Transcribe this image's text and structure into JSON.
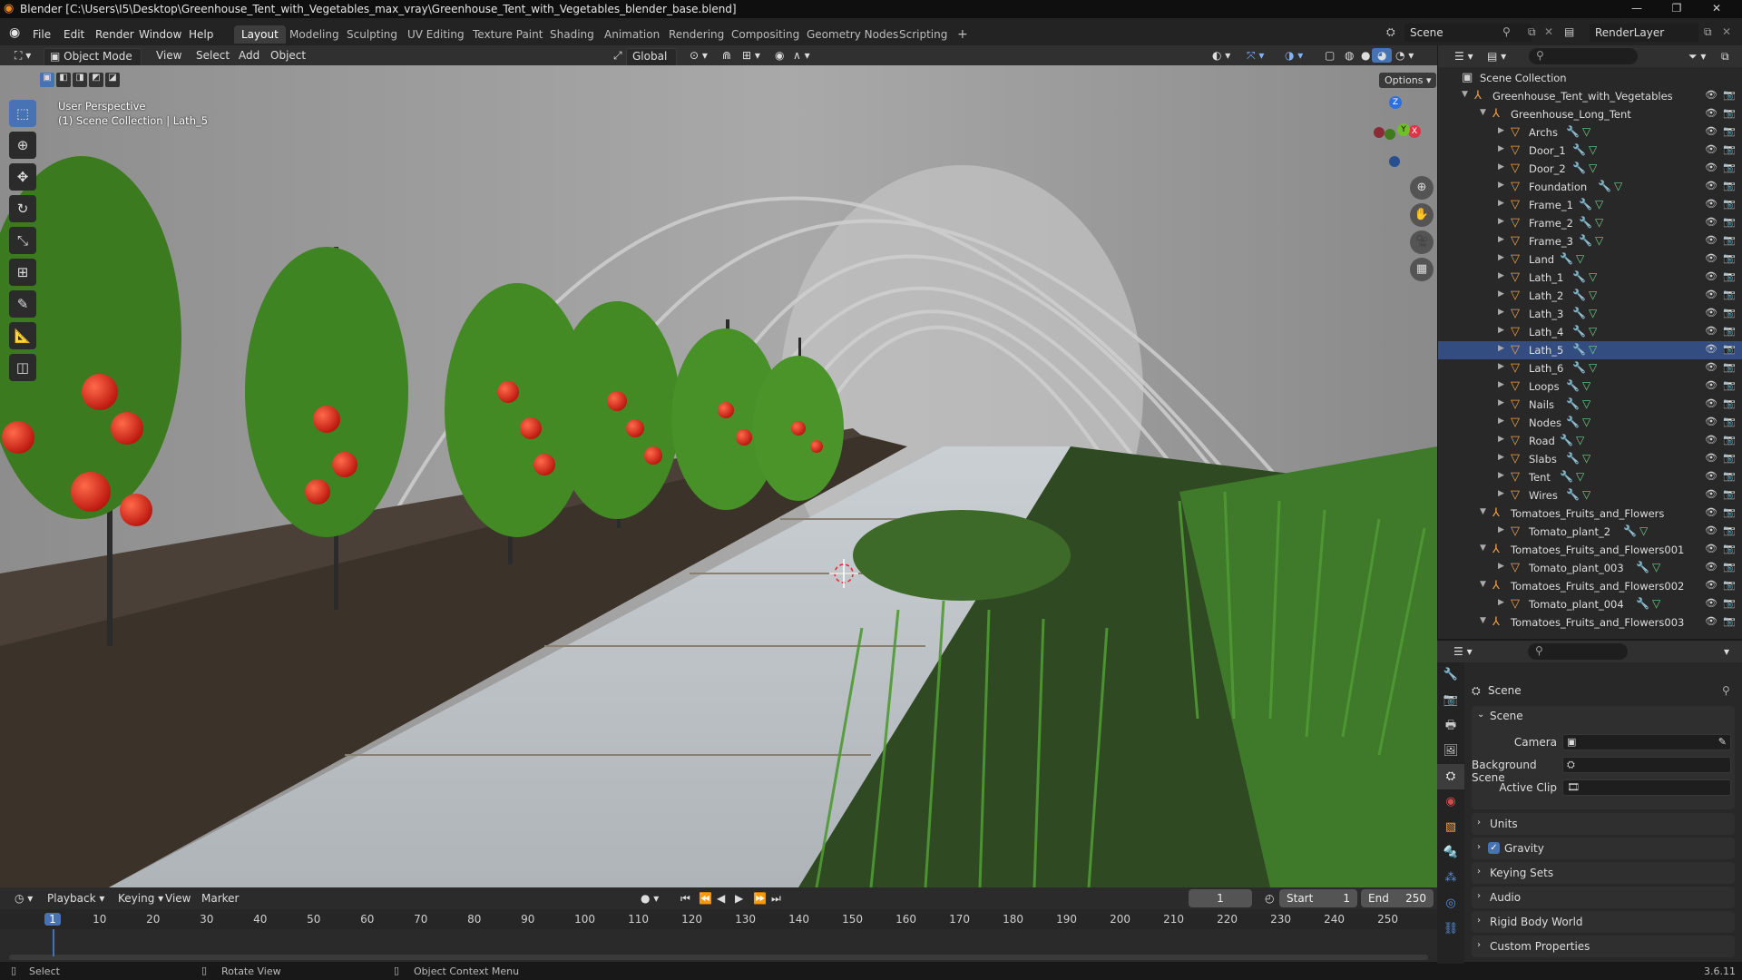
{
  "window": {
    "title": "Blender [C:\\Users\\I5\\Desktop\\Greenhouse_Tent_with_Vegetables_max_vray\\Greenhouse_Tent_with_Vegetables_blender_base.blend]"
  },
  "menu": [
    "File",
    "Edit",
    "Render",
    "Window",
    "Help"
  ],
  "workspaces": [
    "Layout",
    "Modeling",
    "Sculpting",
    "UV Editing",
    "Texture Paint",
    "Shading",
    "Animation",
    "Rendering",
    "Compositing",
    "Geometry Nodes",
    "Scripting"
  ],
  "workspace_add": "+",
  "scene_selector": "Scene",
  "render_layer": "RenderLayer",
  "viewport_header": {
    "mode": "Object Mode",
    "menus": [
      "View",
      "Select",
      "Add",
      "Object"
    ],
    "orientation": "Global",
    "options": "Options"
  },
  "viewport": {
    "perspective": "User Perspective",
    "collection_path": "(1) Scene Collection | Lath_5",
    "gizmo": {
      "x": "X",
      "y": "Y",
      "z": "Z"
    }
  },
  "tools": [
    "select",
    "cursor",
    "move",
    "rotate",
    "scale",
    "transform",
    "annotate",
    "measure",
    "add-cube"
  ],
  "timeline": {
    "menus": [
      "Playback",
      "Keying",
      "View",
      "Marker"
    ],
    "current_frame": "1",
    "start_label": "Start",
    "start": "1",
    "end_label": "End",
    "end": "250",
    "ticks": [
      "1",
      "10",
      "20",
      "30",
      "40",
      "50",
      "60",
      "70",
      "80",
      "90",
      "100",
      "110",
      "120",
      "130",
      "140",
      "150",
      "160",
      "170",
      "180",
      "190",
      "200",
      "210",
      "220",
      "230",
      "240",
      "250"
    ]
  },
  "statusbar": {
    "select": "Select",
    "rotate": "Rotate View",
    "context": "Object Context Menu",
    "version": "3.6.11"
  },
  "outliner": {
    "root": "Scene Collection",
    "rows": [
      {
        "label": "Greenhouse_Tent_with_Vegetables",
        "depth": 1,
        "kind": "empty",
        "expanded": true
      },
      {
        "label": "Greenhouse_Long_Tent",
        "depth": 2,
        "kind": "empty",
        "expanded": true
      },
      {
        "label": "Archs",
        "depth": 3,
        "kind": "mesh"
      },
      {
        "label": "Door_1",
        "depth": 3,
        "kind": "mesh"
      },
      {
        "label": "Door_2",
        "depth": 3,
        "kind": "mesh"
      },
      {
        "label": "Foundation",
        "depth": 3,
        "kind": "mesh"
      },
      {
        "label": "Frame_1",
        "depth": 3,
        "kind": "mesh"
      },
      {
        "label": "Frame_2",
        "depth": 3,
        "kind": "mesh"
      },
      {
        "label": "Frame_3",
        "depth": 3,
        "kind": "mesh"
      },
      {
        "label": "Land",
        "depth": 3,
        "kind": "mesh"
      },
      {
        "label": "Lath_1",
        "depth": 3,
        "kind": "mesh"
      },
      {
        "label": "Lath_2",
        "depth": 3,
        "kind": "mesh"
      },
      {
        "label": "Lath_3",
        "depth": 3,
        "kind": "mesh"
      },
      {
        "label": "Lath_4",
        "depth": 3,
        "kind": "mesh"
      },
      {
        "label": "Lath_5",
        "depth": 3,
        "kind": "mesh",
        "selected": true
      },
      {
        "label": "Lath_6",
        "depth": 3,
        "kind": "mesh"
      },
      {
        "label": "Loops",
        "depth": 3,
        "kind": "mesh"
      },
      {
        "label": "Nails",
        "depth": 3,
        "kind": "mesh"
      },
      {
        "label": "Nodes",
        "depth": 3,
        "kind": "mesh"
      },
      {
        "label": "Road",
        "depth": 3,
        "kind": "mesh"
      },
      {
        "label": "Slabs",
        "depth": 3,
        "kind": "mesh"
      },
      {
        "label": "Tent",
        "depth": 3,
        "kind": "mesh"
      },
      {
        "label": "Wires",
        "depth": 3,
        "kind": "mesh"
      },
      {
        "label": "Tomatoes_Fruits_and_Flowers",
        "depth": 2,
        "kind": "empty",
        "expanded": true
      },
      {
        "label": "Tomato_plant_2",
        "depth": 3,
        "kind": "mesh"
      },
      {
        "label": "Tomatoes_Fruits_and_Flowers001",
        "depth": 2,
        "kind": "empty",
        "expanded": true
      },
      {
        "label": "Tomato_plant_003",
        "depth": 3,
        "kind": "mesh"
      },
      {
        "label": "Tomatoes_Fruits_and_Flowers002",
        "depth": 2,
        "kind": "empty",
        "expanded": true
      },
      {
        "label": "Tomato_plant_004",
        "depth": 3,
        "kind": "mesh"
      },
      {
        "label": "Tomatoes_Fruits_and_Flowers003",
        "depth": 2,
        "kind": "empty",
        "expanded": true
      }
    ]
  },
  "properties": {
    "context": "Scene",
    "section": "Scene",
    "fields": [
      {
        "label": "Camera"
      },
      {
        "label": "Background Scene"
      },
      {
        "label": "Active Clip"
      }
    ],
    "panels": [
      "Units",
      "Gravity",
      "Keying Sets",
      "Audio",
      "Rigid Body World",
      "Custom Properties"
    ],
    "gravity_checked": true
  },
  "colors": {
    "accent": "#4772b3",
    "selected_row": "#334d80",
    "object_icon": "#f0a04a",
    "mesh_icon": "#6fd08a"
  }
}
